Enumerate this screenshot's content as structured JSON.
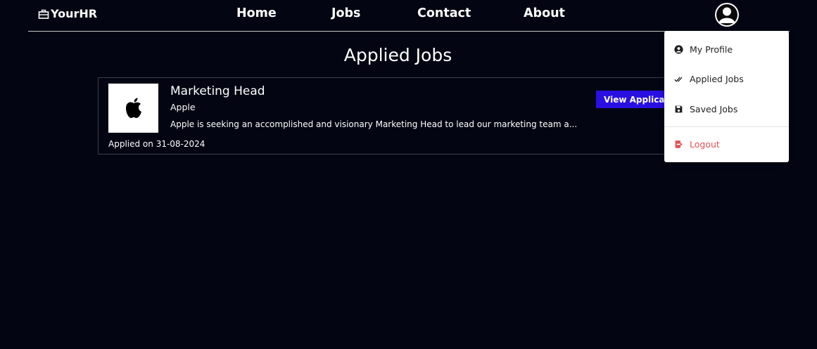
{
  "brand": {
    "name": "YourHR",
    "icon": "briefcase-icon"
  },
  "nav": {
    "home": "Home",
    "jobs": "Jobs",
    "contact": "Contact",
    "about": "About"
  },
  "page": {
    "title": "Applied Jobs"
  },
  "jobs": [
    {
      "title": "Marketing Head",
      "company": "Apple",
      "description": "Apple is seeking an accomplished and visionary Marketing Head to lead our marketing team a...",
      "applied_on": "Applied on 31-08-2024",
      "view_button": "View Applicatio",
      "logo": "apple-logo"
    }
  ],
  "user_menu": {
    "items": [
      {
        "label": "My Profile",
        "icon": "user-circle-icon"
      },
      {
        "label": "Applied Jobs",
        "icon": "double-check-icon"
      },
      {
        "label": "Saved Jobs",
        "icon": "save-icon"
      }
    ],
    "logout": {
      "label": "Logout",
      "icon": "logout-icon"
    }
  },
  "colors": {
    "background": "#030612",
    "accent": "#2a0fe3",
    "logout": "#e05252"
  }
}
